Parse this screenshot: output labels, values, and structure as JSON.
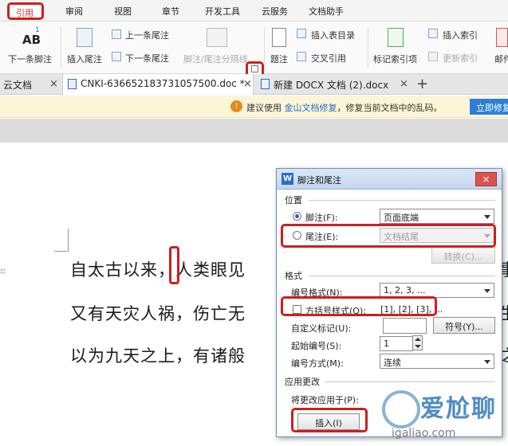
{
  "menu": {
    "active": "引用",
    "items": [
      "审阅",
      "视图",
      "章节",
      "开发工具",
      "云服务",
      "文档助手"
    ]
  },
  "ribbon": {
    "next_footnote": "下一条脚注",
    "ab_glyph": "AB",
    "ab_sup": "1",
    "insert_endnote": "插入尾注",
    "prev_endnote": "上一条尾注",
    "next_endnote": "下一条尾注",
    "note_separator": "脚注/尾注分隔线",
    "caption": "题注",
    "insert_toc": "插入表目录",
    "cross_ref": "交叉引用",
    "mark_index": "标记索引项",
    "insert_index": "插入索引",
    "update_index": "更新索引",
    "mail": "邮件"
  },
  "tabs": {
    "cloud": "云文档",
    "doc1": "CNKI-636652183731057500.doc *",
    "doc2": "新建 DOCX 文档 (2).docx",
    "close": "×",
    "add": "+"
  },
  "notice": {
    "prefix": "建议使用",
    "link": "金山文档修复",
    "suffix": "，修复当前文档中的乱码。",
    "button": "立即修复"
  },
  "document": {
    "line1": "自太古以来，人类眼见",
    "line2": "又有天灾人祸，伤亡无",
    "line3": "以为九天之上，有诸般",
    "right1": "事",
    "right2": "生",
    "right3": "之"
  },
  "dialog": {
    "title": "脚注和尾注",
    "close": "×",
    "location_group": "位置",
    "footnote_label": "脚注(F):",
    "footnote_value": "页面底端",
    "endnote_label": "尾注(E):",
    "endnote_value": "文档结尾",
    "convert_button": "转换(C)...",
    "format_group": "格式",
    "number_format_label": "编号格式(N):",
    "number_format_value": "1, 2, 3, ...",
    "bracket_style_label": "方括号样式(Q):",
    "bracket_style_value": "[1], [2], [3], ...",
    "custom_mark_label": "自定义标记(U):",
    "custom_mark_value": "",
    "symbol_button": "符号(Y)...",
    "start_label": "起始编号(S):",
    "start_value": "1",
    "numbering_label": "编号方式(M):",
    "numbering_value": "连续",
    "apply_group": "应用更改",
    "apply_to_label": "将更改应用于(P):",
    "insert_button": "插入(I)"
  },
  "watermark": {
    "text": "爱尬聊",
    "url": "igaliao.com"
  },
  "colors": {
    "highlight_red": "#cc1f1f",
    "accent_blue": "#2b80d6",
    "notice_bg": "#fdf5d8"
  }
}
